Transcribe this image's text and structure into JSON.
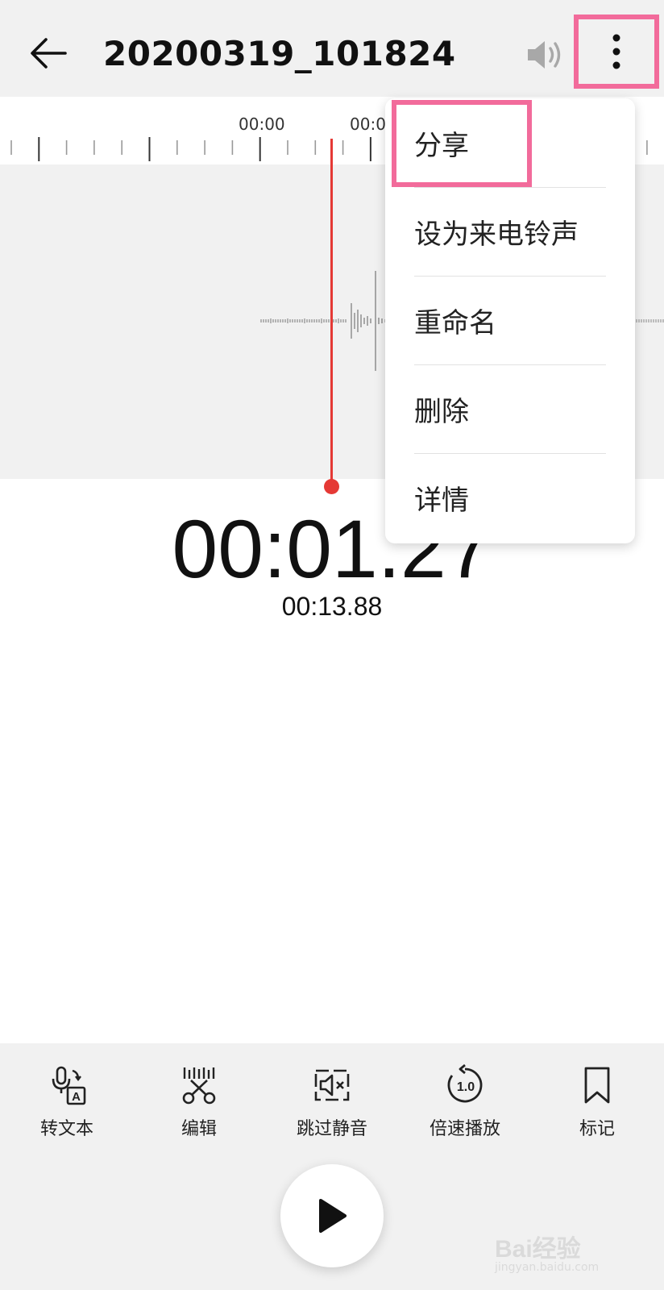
{
  "header": {
    "title": "20200319_101824",
    "back_icon": "arrow-left-icon",
    "volume_icon": "speaker-icon",
    "more_icon": "more-vertical-icon"
  },
  "ruler": {
    "labels": [
      "00:00",
      "00:0"
    ]
  },
  "playback": {
    "current_time": "00:01.27",
    "total_time": "00:13.88",
    "playhead_color": "#e53935"
  },
  "menu": {
    "items": [
      {
        "label": "分享"
      },
      {
        "label": "设为来电铃声"
      },
      {
        "label": "重命名"
      },
      {
        "label": "删除"
      },
      {
        "label": "详情"
      }
    ],
    "highlight_color": "#f26b9b"
  },
  "toolbar": {
    "items": [
      {
        "label": "转文本",
        "icon": "speech-to-text-icon"
      },
      {
        "label": "编辑",
        "icon": "scissors-icon"
      },
      {
        "label": "跳过静音",
        "icon": "skip-silence-icon"
      },
      {
        "label": "倍速播放",
        "icon": "playback-speed-icon",
        "speed": "1.0"
      },
      {
        "label": "标记",
        "icon": "bookmark-icon"
      }
    ],
    "play_icon": "play-icon"
  },
  "watermark": {
    "brand": "Bai经验",
    "sub": "jingyan.baidu.com"
  }
}
